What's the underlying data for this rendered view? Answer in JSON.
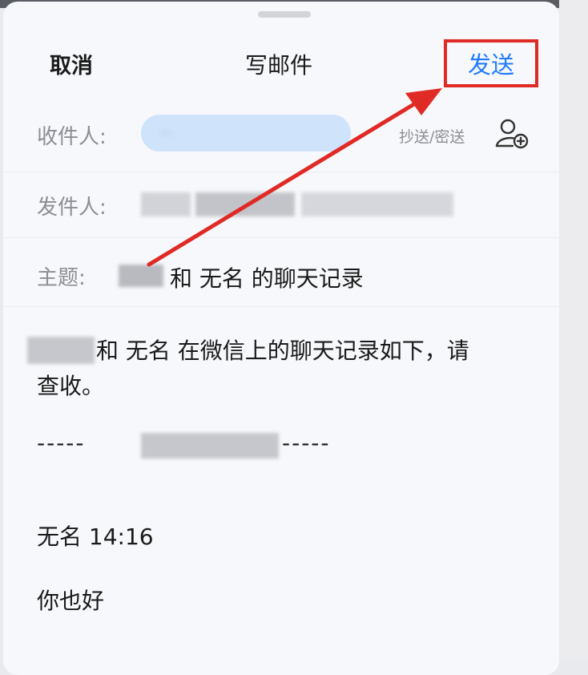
{
  "header": {
    "cancel_label": "取消",
    "title": "写邮件",
    "send_label": "发送"
  },
  "fields": {
    "to_label": "收件人:",
    "to_value": "...",
    "cc_bcc_label": "抄送/密送",
    "from_label": "发件人:",
    "subject_label": "主题:",
    "subject_value": "和 无名 的聊天记录"
  },
  "body": {
    "line1": "和 无名 在微信上的聊天记录如下，请",
    "line2": "查收。",
    "dash_left": "-----",
    "dash_right": "-----",
    "msg_meta": "无名 14:16",
    "msg_text": "你也好"
  },
  "colors": {
    "accent": "#1f7bff",
    "annotation": "#e02a25",
    "chip": "#cfe3fb"
  }
}
